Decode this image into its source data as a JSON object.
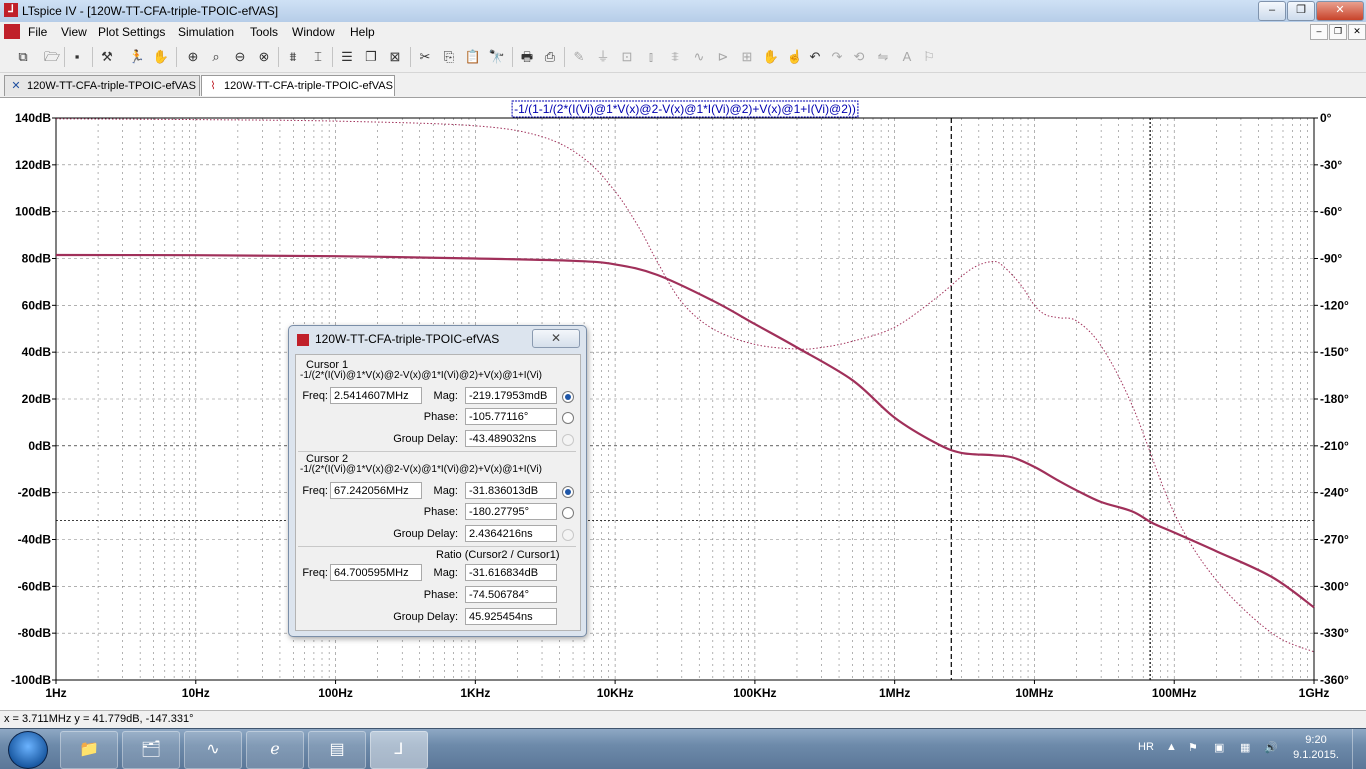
{
  "window": {
    "title": "LTspice IV - [120W-TT-CFA-triple-TPOIC-efVAS]",
    "app_icon": "ltspice-icon",
    "controls": [
      "–",
      "❐",
      "✕"
    ]
  },
  "menu": {
    "items": [
      "File",
      "View",
      "Plot Settings",
      "Simulation",
      "Tools",
      "Window",
      "Help"
    ],
    "mdi_controls": [
      "–",
      "❐",
      "✕"
    ]
  },
  "toolbar": {
    "icons": [
      "new-schematic-icon",
      "open-icon",
      "save-icon",
      "control-panel-icon",
      "run-icon",
      "pan-icon",
      "zoom-in-icon",
      "zoom-area-icon",
      "zoom-out-icon",
      "zoom-fit-icon",
      "autorange-icon",
      "cursor-icon",
      "tile-horizontal-icon",
      "cascade-icon",
      "close-window-icon",
      "cut-icon",
      "copy-icon",
      "paste-icon",
      "find-icon",
      "print-icon",
      "print-preview-icon",
      "print-setup-icon",
      "wire-icon",
      "ground-icon",
      "label-icon",
      "resistor-icon",
      "capacitor-icon",
      "inductor-icon",
      "diode-icon",
      "component-icon",
      "move-icon",
      "drag-icon",
      "undo-icon",
      "redo-icon",
      "rotate-icon",
      "mirror-icon",
      "text-icon",
      "spice-directive-icon"
    ]
  },
  "tabs": [
    {
      "label": "120W-TT-CFA-triple-TPOIC-efVAS",
      "icon": "schematic-icon",
      "active": false
    },
    {
      "label": "120W-TT-CFA-triple-TPOIC-efVAS",
      "icon": "waveform-icon",
      "active": true
    }
  ],
  "plot": {
    "expression": "-1/(1-1/(2*(I(Vi)@1*V(x)@2-V(x)@1*I(Vi)@2)+V(x)@1+I(Vi)@2))",
    "colors": {
      "trace": "#a0305a",
      "grid": "#808080",
      "axis": "#000000"
    }
  },
  "chart_data": {
    "type": "line",
    "title": "-1/(1-1/(2*(I(Vi)@1*V(x)@2-V(x)@1*I(Vi)@2)+V(x)@1+I(Vi)@2))",
    "x_scale": "log",
    "xlim": [
      1,
      1000000000
    ],
    "x_tick_labels": [
      "1Hz",
      "10Hz",
      "100Hz",
      "1KHz",
      "10KHz",
      "100KHz",
      "1MHz",
      "10MHz",
      "100MHz",
      "1GHz"
    ],
    "ylim": [
      -100,
      140
    ],
    "y_tick_labels": [
      "140dB",
      "120dB",
      "100dB",
      "80dB",
      "60dB",
      "40dB",
      "20dB",
      "0dB",
      "-20dB",
      "-40dB",
      "-60dB",
      "-80dB",
      "-100dB"
    ],
    "y2lim": [
      -360,
      0
    ],
    "y2_tick_labels": [
      "0°",
      "-30°",
      "-60°",
      "-90°",
      "-120°",
      "-150°",
      "-180°",
      "-210°",
      "-240°",
      "-270°",
      "-300°",
      "-330°",
      "-360°"
    ],
    "grid": true,
    "series": [
      {
        "style": "solid",
        "axis": "left",
        "x": [
          1,
          10,
          100,
          1000,
          5000,
          10000,
          20000,
          50000,
          100000,
          200000,
          500000,
          1000000,
          2000000,
          3000000,
          5000000,
          7000000,
          10000000,
          15000000,
          20000000,
          30000000,
          50000000,
          70000000,
          100000000,
          200000000,
          500000000,
          1000000000
        ],
        "values": [
          81.5,
          81.4,
          81,
          80,
          79,
          77.5,
          73,
          62,
          52,
          42,
          28,
          12,
          1,
          -3,
          -4,
          -5,
          -9,
          -15,
          -19,
          -24,
          -28,
          -33,
          -37,
          -45,
          -56,
          -69
        ]
      },
      {
        "style": "dotted",
        "axis": "right",
        "x": [
          1,
          10,
          100,
          1000,
          3000,
          6000,
          10000,
          15000,
          20000,
          30000,
          50000,
          100000,
          200000,
          300000,
          500000,
          1000000,
          2000000,
          3500000,
          5000000,
          6000000,
          8000000,
          10000000,
          12000000,
          15000000,
          20000000,
          30000000,
          50000000,
          100000000,
          200000000,
          500000000,
          1000000000
        ],
        "values": [
          -0.5,
          -1,
          -2,
          -5,
          -12,
          -26,
          -47,
          -71,
          -92,
          -118,
          -135,
          -145,
          -148,
          -147,
          -143,
          -134,
          -115,
          -97,
          -92,
          -95,
          -107,
          -120,
          -126,
          -128,
          -130,
          -146,
          -184,
          -253,
          -296,
          -330,
          -342
        ]
      }
    ],
    "cursors": [
      {
        "x": 2541460.7,
        "style": "dashed",
        "label": "1"
      },
      {
        "x": 67242056,
        "style": "dotted",
        "label": "2"
      }
    ],
    "cursor2_level_db": -31.836013
  },
  "dialog": {
    "title": "120W-TT-CFA-triple-TPOIC-efVAS",
    "close": "✕",
    "cursor1": {
      "heading": "Cursor 1",
      "expr": "-1/(2*(I(Vi)@1*V(x)@2-V(x)@1*I(Vi)@2)+V(x)@1+I(Vi)",
      "freq_label": "Freq:",
      "freq": "2.5414607MHz",
      "mag_label": "Mag:",
      "mag": "-219.17953mdB",
      "phase_label": "Phase:",
      "phase": "-105.77116°",
      "gd_label": "Group Delay:",
      "gd": "-43.489032ns"
    },
    "cursor2": {
      "heading": "Cursor 2",
      "expr": "-1/(2*(I(Vi)@1*V(x)@2-V(x)@1*I(Vi)@2)+V(x)@1+I(Vi)",
      "freq_label": "Freq:",
      "freq": "67.242056MHz",
      "mag_label": "Mag:",
      "mag": "-31.836013dB",
      "phase_label": "Phase:",
      "phase": "-180.27795°",
      "gd_label": "Group Delay:",
      "gd": "2.4364216ns"
    },
    "ratio": {
      "heading": "Ratio (Cursor2 / Cursor1)",
      "freq_label": "Freq:",
      "freq": "64.700595MHz",
      "mag_label": "Mag:",
      "mag": "-31.616834dB",
      "phase_label": "Phase:",
      "phase": "-74.506784°",
      "gd_label": "Group Delay:",
      "gd": "45.925454ns"
    }
  },
  "status": {
    "text": "x = 3.711MHz    y = 41.779dB, -147.331°"
  },
  "taskbar": {
    "apps": [
      "explorer-icon",
      "office-icon",
      "scope-icon",
      "ie-icon",
      "presentation-icon",
      "ltspice-taskbar-icon"
    ],
    "lang": "HR",
    "time": "9:20",
    "date": "9.1.2015."
  }
}
